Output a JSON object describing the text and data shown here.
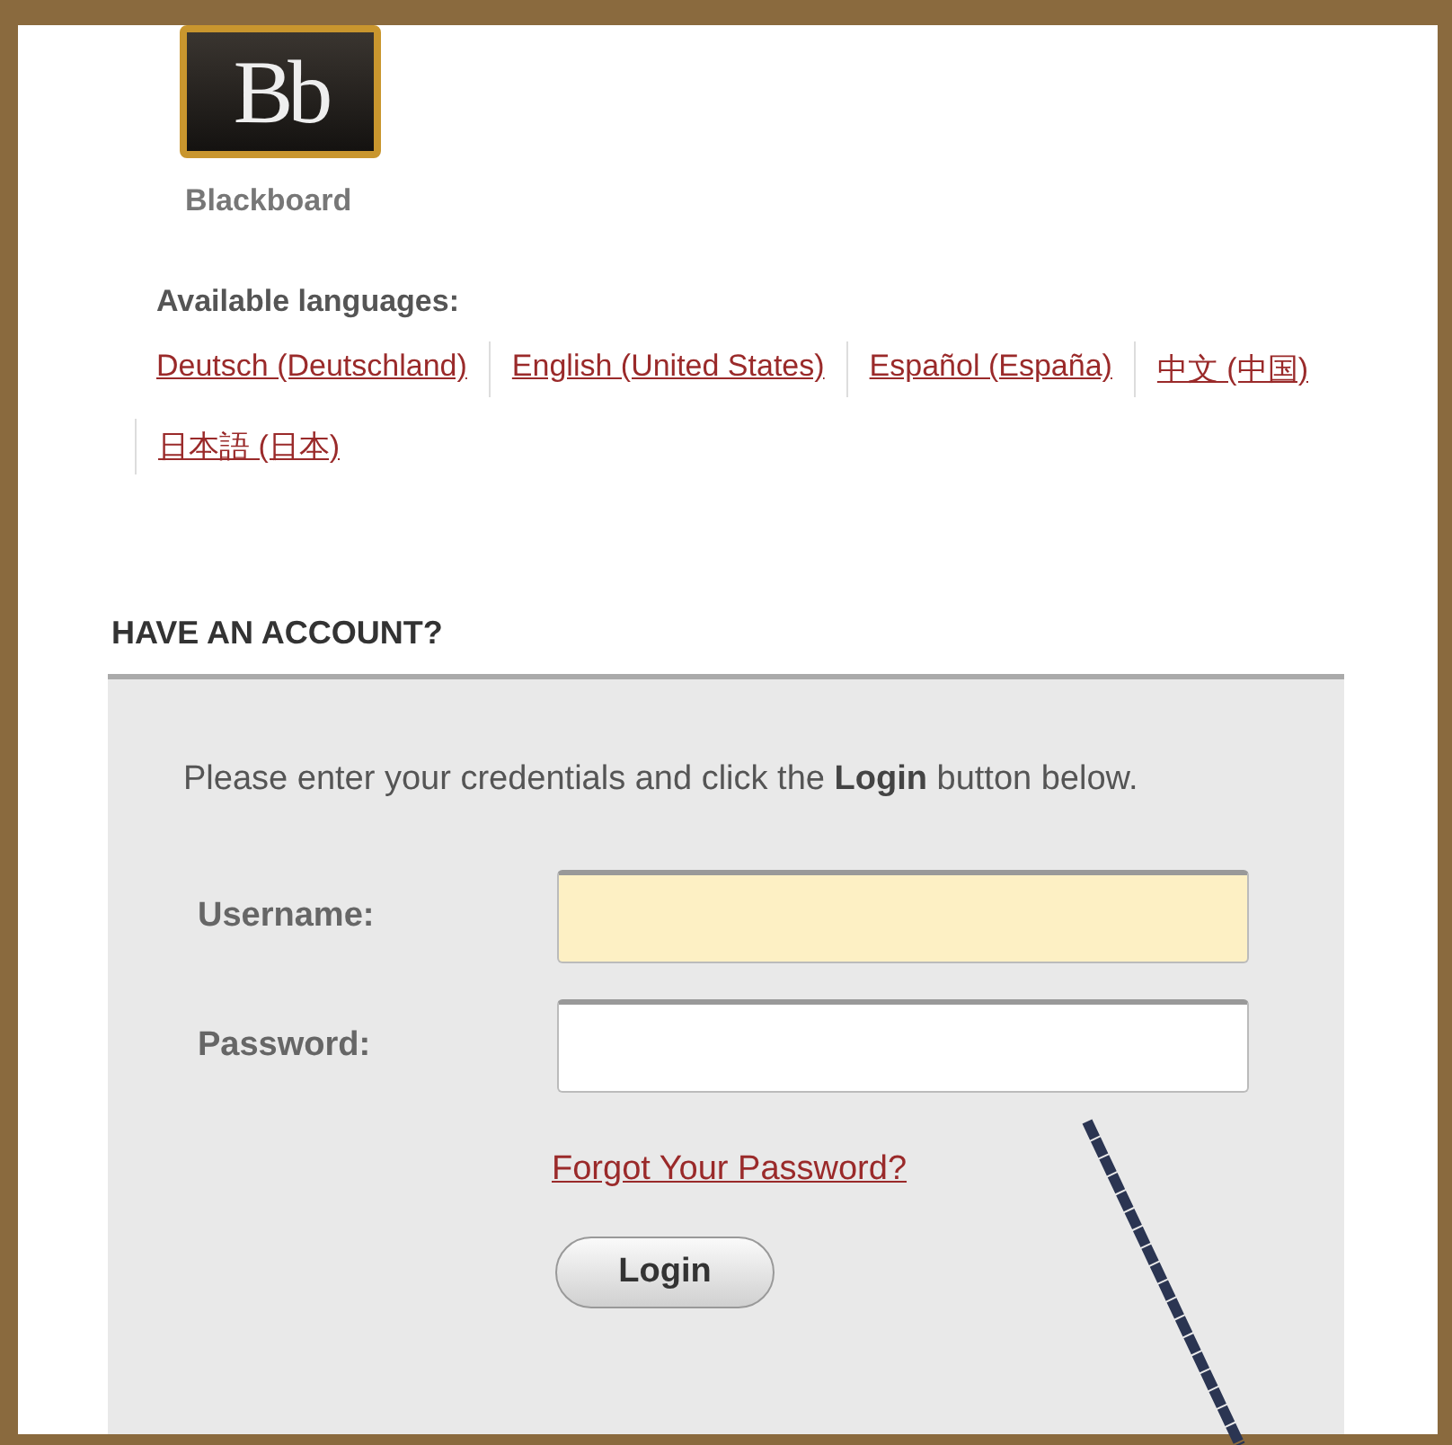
{
  "logo": {
    "mark": "Bb",
    "name": "Blackboard"
  },
  "languages": {
    "label": "Available languages:",
    "links": [
      {
        "label": "Deutsch (Deutschland)"
      },
      {
        "label": "English (United States)"
      },
      {
        "label": "Español (España)"
      },
      {
        "label": "中文 (中国)"
      },
      {
        "label": "日本語 (日本)"
      }
    ]
  },
  "login": {
    "heading": "HAVE AN ACCOUNT?",
    "intro": "Please enter your credentials and click the **Login** button below.",
    "fields": [
      {
        "label": "Username:",
        "focused": true
      },
      {
        "label": "Password:",
        "focused": false
      }
    ],
    "forgot_link": "Forgot Your Password?",
    "button": "Login"
  }
}
